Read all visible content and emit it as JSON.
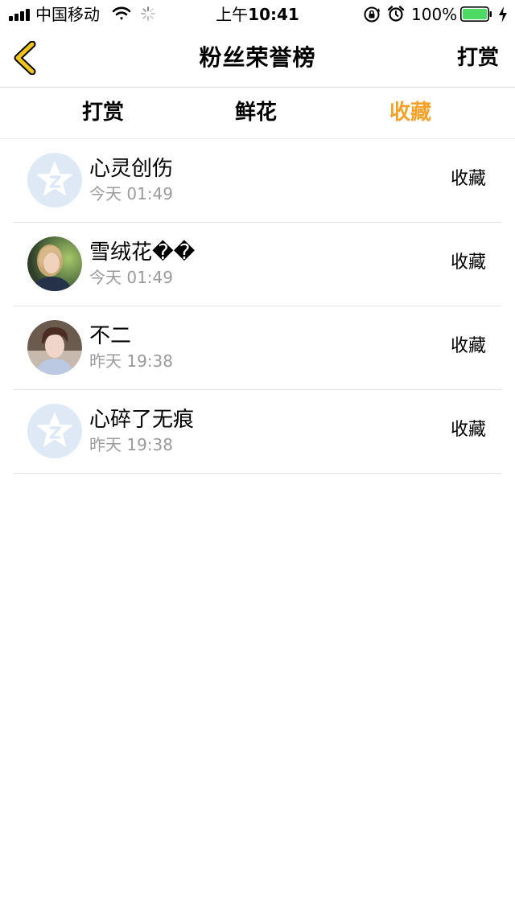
{
  "status_bar": {
    "carrier": "中国移动",
    "time_prefix": "上午",
    "time": "10:41",
    "battery_percent": "100%",
    "battery_color": "#4cd964",
    "icons": [
      "signal-icon",
      "wifi-icon",
      "activity-spinner-icon",
      "rotation-lock-icon",
      "alarm-icon",
      "battery-icon",
      "charging-bolt-icon"
    ]
  },
  "nav": {
    "title": "粉丝荣誉榜",
    "right_action": "打赏",
    "back_icon": "chevron-left-icon",
    "back_color": "#f0c419"
  },
  "tabs": [
    {
      "label": "打赏",
      "active": false
    },
    {
      "label": "鲜花",
      "active": false
    },
    {
      "label": "收藏",
      "active": true
    }
  ],
  "accent_color": "#f5a22a",
  "list": [
    {
      "name": "心灵创伤",
      "time": "今天 01:49",
      "action": "收藏",
      "avatar": "default-qq-avatar"
    },
    {
      "name": "雪绒花��",
      "time": "今天 01:49",
      "action": "收藏",
      "avatar": "photo-avatar-girl"
    },
    {
      "name": "不二",
      "time": "昨天 19:38",
      "action": "收藏",
      "avatar": "photo-avatar-boy"
    },
    {
      "name": "心碎了无痕",
      "time": "昨天 19:38",
      "action": "收藏",
      "avatar": "default-qq-avatar"
    }
  ]
}
